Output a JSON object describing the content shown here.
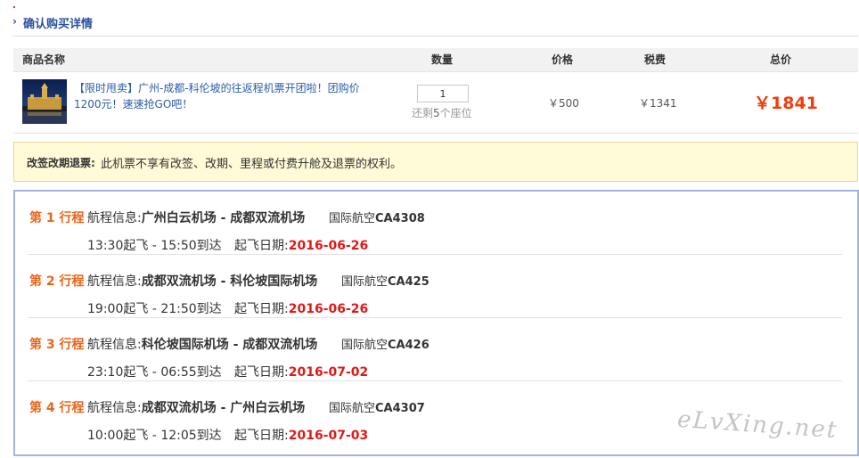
{
  "header": {
    "title": "确认购买详情",
    "chevron_icon": "chevron-right-icon"
  },
  "table": {
    "columns": [
      "商品名称",
      "数量",
      "价格",
      "税费",
      "总价"
    ],
    "product": {
      "image_icon": "landmark-photo",
      "title": "【限时甩卖】广州-成都-科伦坡的往返程机票开团啦！团购价1200元！速速抢GO吧！",
      "quantity": "1",
      "remaining_prefix": "还剩",
      "remaining_count": "5",
      "remaining_suffix": "个座位",
      "price": "￥500",
      "tax": "￥1341",
      "total": "￥1841"
    }
  },
  "notice": {
    "label": "改签改期退票:",
    "text": "此机票不享有改签、改期、里程或付费升舱及退票的权利。"
  },
  "itinerary": {
    "route_label": "航程信息:",
    "airline_prefix": "国际航空",
    "depart_suffix": "起飞",
    "arrive_suffix": "到达",
    "date_label": "起飞日期:",
    "legs": [
      {
        "label": "第 1 行程",
        "route": "广州白云机场 - 成都双流机场",
        "flight": "CA4308",
        "dep_time": "13:30",
        "arr_time": "15:50",
        "date": "2016-06-26"
      },
      {
        "label": "第 2 行程",
        "route": "成都双流机场 - 科伦坡国际机场",
        "flight": "CA425",
        "dep_time": "19:00",
        "arr_time": "21:50",
        "date": "2016-06-26"
      },
      {
        "label": "第 3 行程",
        "route": "科伦坡国际机场 - 成都双流机场",
        "flight": "CA426",
        "dep_time": "23:10",
        "arr_time": "06:55",
        "date": "2016-07-02"
      },
      {
        "label": "第 4 行程",
        "route": "成都双流机场 - 广州白云机场",
        "flight": "CA4307",
        "dep_time": "10:00",
        "arr_time": "12:05",
        "date": "2016-07-03"
      }
    ]
  },
  "watermark": "eLvXing.net",
  "colors": {
    "accent_blue": "#2a4fa0",
    "price_red": "#f03c0c",
    "date_red": "#e21818",
    "leg_orange": "#e8661a",
    "notice_bg": "#fffbd8"
  }
}
